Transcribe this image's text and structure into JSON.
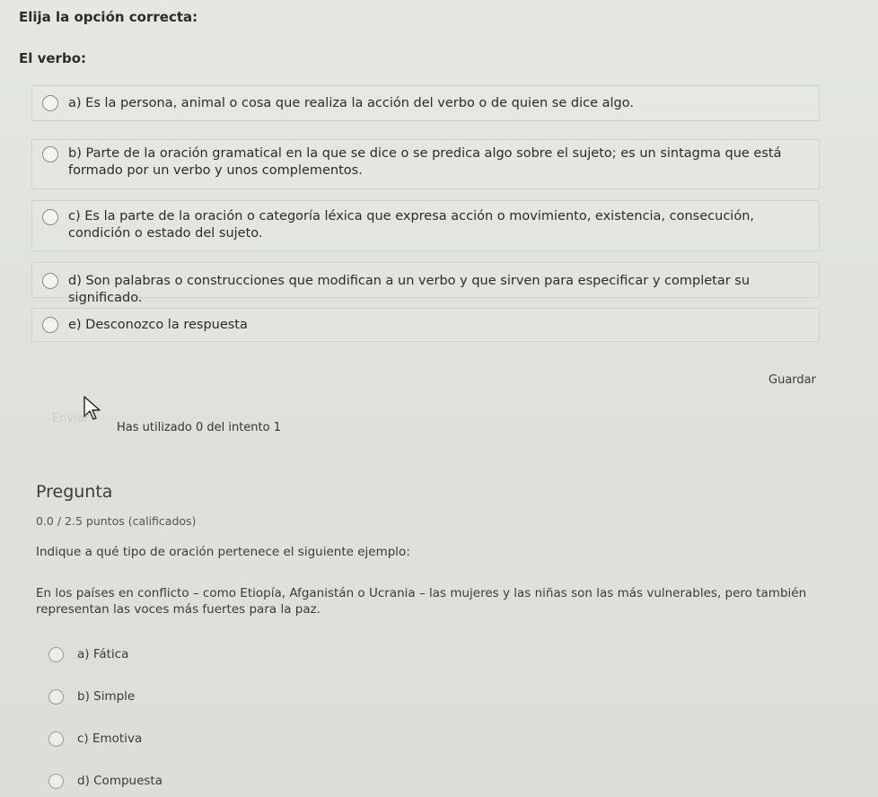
{
  "question1": {
    "instruction": "Elija la opción correcta:",
    "stem": "El verbo:",
    "options": [
      {
        "label": "a) Es la persona, animal o cosa que realiza la acción del verbo o de quien se dice algo."
      },
      {
        "label": "b) Parte de la oración gramatical en la que se dice o se predica algo sobre el sujeto; es un sintagma que está formado por un verbo y unos complementos."
      },
      {
        "label": "c) Es la parte de la oración o categoría léxica que expresa acción o movimiento, existencia, consecución, condición o estado del sujeto."
      },
      {
        "label": "d) Son palabras o construcciones que modifican a un verbo y que sirven para especificar y completar su significado."
      },
      {
        "label": "e) Desconozco la respuesta"
      }
    ],
    "save_label": "Guardar",
    "submit_label": "Enviar",
    "attempts_text": "Has utilizado 0 del intento 1"
  },
  "question2": {
    "title": "Pregunta",
    "score": "0.0 / 2.5 puntos (calificados)",
    "prompt": "Indique a qué tipo de oración pertenece el siguiente ejemplo:",
    "example": "En los países en conflicto – como Etiopía, Afganistán o Ucrania – las mujeres y las niñas son las más vulnerables, pero también representan las voces más fuertes para la paz.",
    "options": [
      {
        "label": "a) Fática"
      },
      {
        "label": "b) Simple"
      },
      {
        "label": "c) Emotiva"
      },
      {
        "label": "d) Compuesta"
      }
    ]
  },
  "colors": {
    "background": "#dfe1db",
    "text": "#2a2c2a",
    "border": "#cfd1ca"
  }
}
